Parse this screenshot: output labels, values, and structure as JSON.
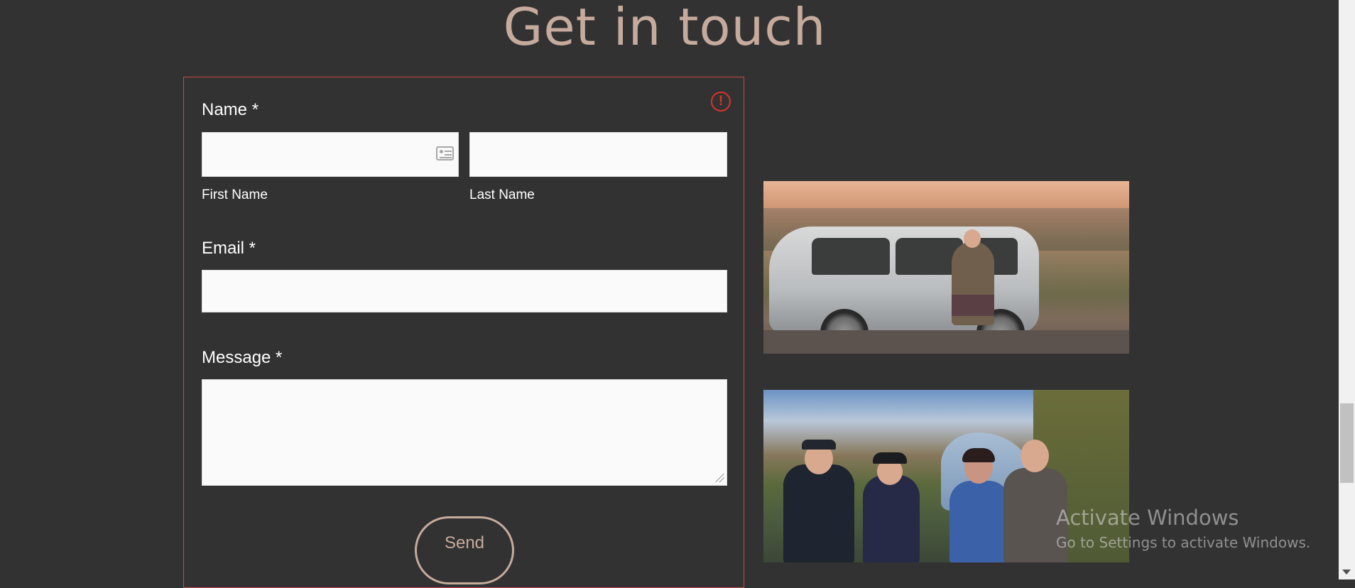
{
  "heading": "Get in touch",
  "form": {
    "name_label": "Name *",
    "first_name_label": "First Name",
    "last_name_label": "Last Name",
    "first_name_value": "",
    "last_name_value": "",
    "email_label": "Email *",
    "email_value": "",
    "message_label": "Message *",
    "message_value": "",
    "error_icon": "exclamation-circle-icon",
    "autofill_icon": "contact-card-icon",
    "send_label": "Send"
  },
  "photos": [
    {
      "name": "van-photo"
    },
    {
      "name": "group-photo"
    }
  ],
  "watermark": {
    "title": "Activate Windows",
    "subtitle": "Go to Settings to activate Windows."
  },
  "colors": {
    "background": "#333233",
    "accent": "#c6ab9c",
    "error": "#d9342b",
    "field": "#fafafa"
  }
}
